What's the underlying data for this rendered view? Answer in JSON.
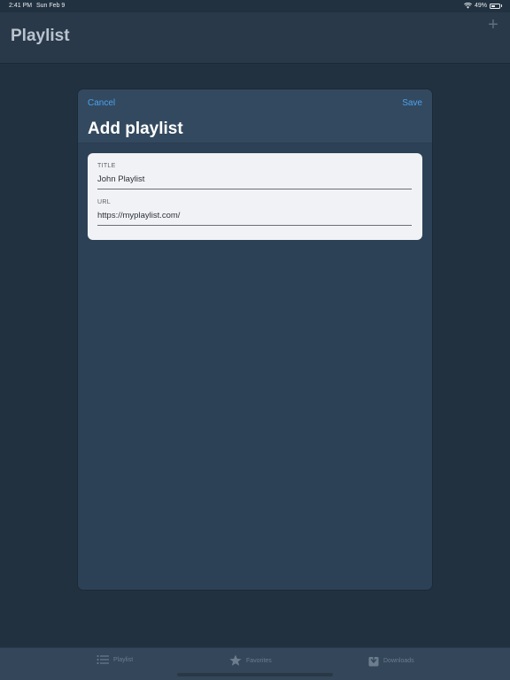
{
  "status_bar": {
    "time": "2:41 PM",
    "date": "Sun Feb 9",
    "battery": "49%",
    "battery_level": 0.49
  },
  "page": {
    "title": "Playlist",
    "add_icon": "plus-icon"
  },
  "modal": {
    "cancel_label": "Cancel",
    "save_label": "Save",
    "title": "Add playlist",
    "fields": [
      {
        "label": "TITLE",
        "value": "John Playlist"
      },
      {
        "label": "URL",
        "value": "https://myplaylist.com/"
      }
    ]
  },
  "tab_bar": {
    "tabs": [
      {
        "label": "Playlist",
        "icon": "list-icon"
      },
      {
        "label": "Favorites",
        "icon": "star-icon"
      },
      {
        "label": "Downloads",
        "icon": "download-icon"
      }
    ]
  },
  "colors": {
    "accent": "#4aa3f0",
    "background": "#22313f",
    "modal": "#2d4156",
    "card": "#f1f2f6"
  }
}
